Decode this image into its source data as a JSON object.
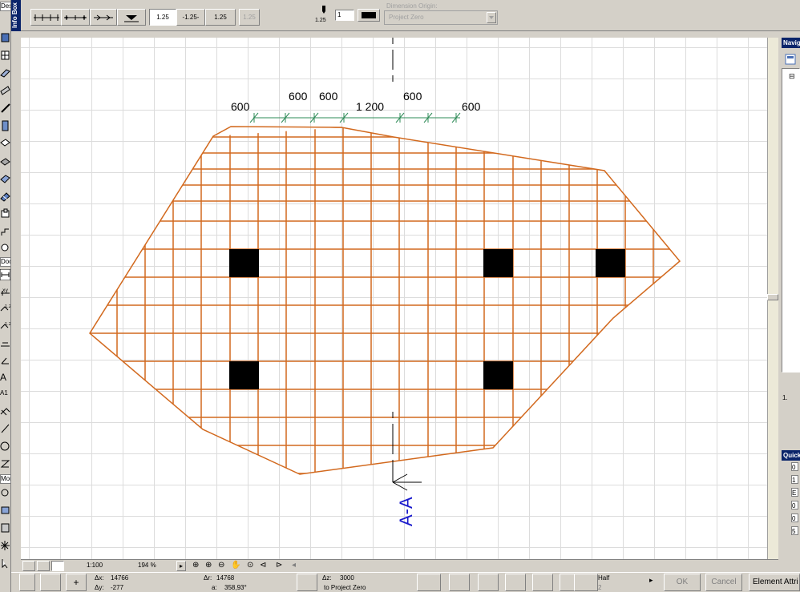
{
  "infobox": {
    "title": "Info Box",
    "marker_value_1": "1.25",
    "marker_value_2": "-1.25-",
    "marker_value_3": "1.25",
    "marker_value_4": "1.25",
    "pen_size": "1.25",
    "pen_number": "1",
    "dimension_origin_label": "Dimension Origin:",
    "dimension_origin_value": "Project Zero"
  },
  "toolbox": {
    "label_design": "Design",
    "label_document": "Docum",
    "label_more": "More",
    "label_text": "A",
    "label_label": "A1"
  },
  "drawing": {
    "dimensions": [
      "600",
      "600",
      "600",
      "1 200",
      "600",
      "600"
    ],
    "section_label": "A-A",
    "line_color": "#d2691e",
    "column_color": "#000000",
    "section_color": "#0000cc"
  },
  "navigator": {
    "title": "Navigator",
    "tree_item": "1."
  },
  "quick_options": {
    "title": "Quick Options",
    "rows": [
      "0",
      "1",
      "E",
      "0",
      "0",
      "5"
    ]
  },
  "bottombar": {
    "scale": "1:100",
    "zoom": "194 %"
  },
  "statusbar": {
    "dx_label": "Δx:",
    "dx_value": "14766",
    "dy_label": "Δy:",
    "dy_value": "-277",
    "dr_label": "Δr:",
    "dr_value": "14768",
    "angle_label": "a:",
    "angle_value": "358,93°",
    "dz_label": "Δz:",
    "dz_value": "3000",
    "dz_ref": "to Project Zero",
    "snap_label": "Half",
    "snap_value": "2",
    "ok": "OK",
    "cancel": "Cancel",
    "element_attributes": "Element Attri"
  }
}
